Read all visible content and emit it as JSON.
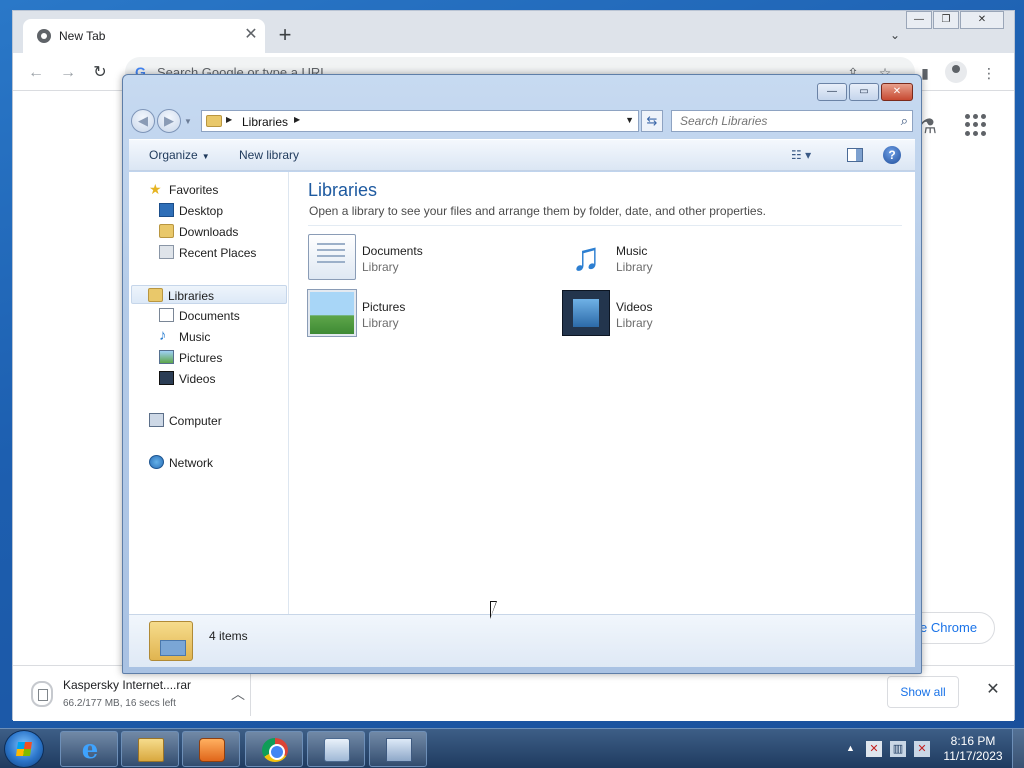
{
  "chrome": {
    "tab_title": "New Tab",
    "omnibox_placeholder": "Search Google or type a URL",
    "customize_label": "e Chrome",
    "download": {
      "file_name": "Kaspersky Internet....rar",
      "status": "66.2/177 MB, 16 secs left"
    },
    "show_all_label": "Show all"
  },
  "explorer": {
    "address": {
      "location": "Libraries"
    },
    "search_placeholder": "Search Libraries",
    "toolbar": {
      "organize_label": "Organize",
      "new_library_label": "New library"
    },
    "nav": {
      "favorites": "Favorites",
      "desktop": "Desktop",
      "downloads": "Downloads",
      "recent_places": "Recent Places",
      "libraries": "Libraries",
      "documents": "Documents",
      "music": "Music",
      "pictures": "Pictures",
      "videos": "Videos",
      "computer": "Computer",
      "network": "Network"
    },
    "content": {
      "title": "Libraries",
      "subtitle": "Open a library to see your files and arrange them by folder, date, and other properties.",
      "items": [
        {
          "name": "Documents",
          "type": "Library"
        },
        {
          "name": "Music",
          "type": "Library"
        },
        {
          "name": "Pictures",
          "type": "Library"
        },
        {
          "name": "Videos",
          "type": "Library"
        }
      ]
    },
    "status": {
      "count": "4 items"
    }
  },
  "taskbar": {
    "clock_time": "8:16 PM",
    "clock_date": "11/17/2023"
  }
}
